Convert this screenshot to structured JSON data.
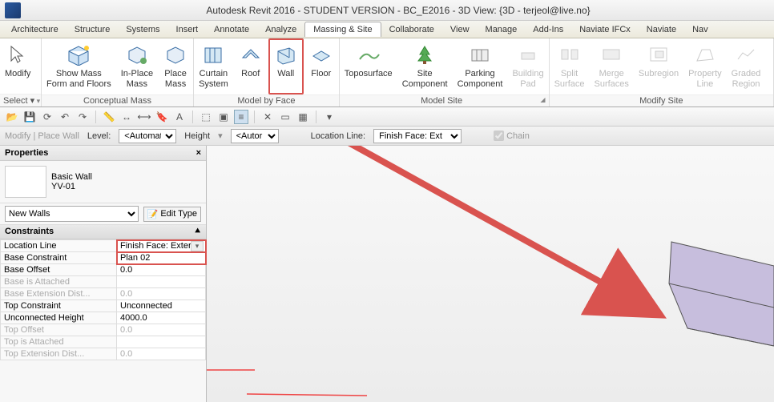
{
  "app": {
    "title": "Autodesk Revit 2016 - STUDENT VERSION -     BC_E2016 - 3D View: {3D - terjeol@live.no}"
  },
  "tabs": [
    "Architecture",
    "Structure",
    "Systems",
    "Insert",
    "Annotate",
    "Analyze",
    "Massing & Site",
    "Collaborate",
    "View",
    "Manage",
    "Add-Ins",
    "Naviate IFCx",
    "Naviate",
    "Nav"
  ],
  "active_tab_index": 6,
  "ribbon": {
    "modify": {
      "label": "Modify",
      "select": "Select ▾"
    },
    "conceptual": {
      "show_mass": "Show Mass\nForm and Floors",
      "inplace": "In-Place\nMass",
      "place": "Place\nMass",
      "caption": "Conceptual Mass"
    },
    "byface": {
      "curtain": "Curtain\nSystem",
      "roof": "Roof",
      "wall": "Wall",
      "floor": "Floor",
      "caption": "Model by Face"
    },
    "site": {
      "topo": "Toposurface",
      "sitecomp": "Site\nComponent",
      "parking": "Parking\nComponent",
      "pad": "Building\nPad",
      "caption": "Model Site"
    },
    "modsite": {
      "split": "Split\nSurface",
      "merge": "Merge\nSurfaces",
      "sub": "Subregion",
      "pline": "Property\nLine",
      "graded": "Graded\nRegion",
      "caption": "Modify Site"
    }
  },
  "options": {
    "mode": "Modify | Place Wall",
    "level_lbl": "Level:",
    "level_val": "<Automati",
    "height_lbl": "Height",
    "height_val": "<Autor",
    "locline_lbl": "Location Line:",
    "locline_val": "Finish Face: Ext",
    "chain_lbl": "Chain"
  },
  "palette": {
    "title": "Properties",
    "type_family": "Basic Wall",
    "type_name": "YV-01",
    "filter": "New Walls",
    "edit_type": "Edit Type",
    "group": "Constraints",
    "rows": [
      {
        "k": "Location Line",
        "v": "Finish Face: Exteri...",
        "hl": true,
        "combo": true
      },
      {
        "k": "Base Constraint",
        "v": "Plan 02",
        "hl": true
      },
      {
        "k": "Base Offset",
        "v": "0.0"
      },
      {
        "k": "Base is Attached",
        "v": "",
        "dim": true
      },
      {
        "k": "Base Extension Dist...",
        "v": "0.0",
        "dim": true
      },
      {
        "k": "Top Constraint",
        "v": "Unconnected"
      },
      {
        "k": "Unconnected Height",
        "v": "4000.0"
      },
      {
        "k": "Top Offset",
        "v": "0.0",
        "dim": true
      },
      {
        "k": "Top is Attached",
        "v": "",
        "dim": true
      },
      {
        "k": "Top Extension Dist...",
        "v": "0.0",
        "dim": true
      }
    ]
  },
  "colors": {
    "hl": "#d9534f",
    "model": "#b3a9cf"
  }
}
